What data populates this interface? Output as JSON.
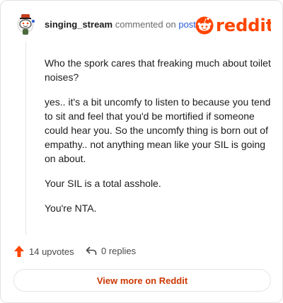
{
  "comment": {
    "username": "singing_stream",
    "commented_text": "commented on",
    "post_link_text": "post",
    "paragraphs": [
      "Who the spork cares that freaking much about toilet noises?",
      "yes.. it's a bit uncomfy to listen to because you tend to sit and feel that you'd be mortified if someone could hear you. So the uncomfy thing is born out of empathy.. not anything mean like your SIL is going on about.",
      "Your SIL is a total asshole.",
      "You're NTA."
    ]
  },
  "brand": {
    "wordmark": "reddit",
    "color": "#ff4500"
  },
  "footer": {
    "upvotes_label": "14 upvotes",
    "replies_label": "0 replies",
    "view_button_label": "View more on Reddit"
  },
  "icons": {
    "avatar": "snoo-avatar-icon",
    "logo": "reddit-logo-icon",
    "upvote": "upvote-arrow-icon",
    "reply": "reply-arrow-icon"
  }
}
